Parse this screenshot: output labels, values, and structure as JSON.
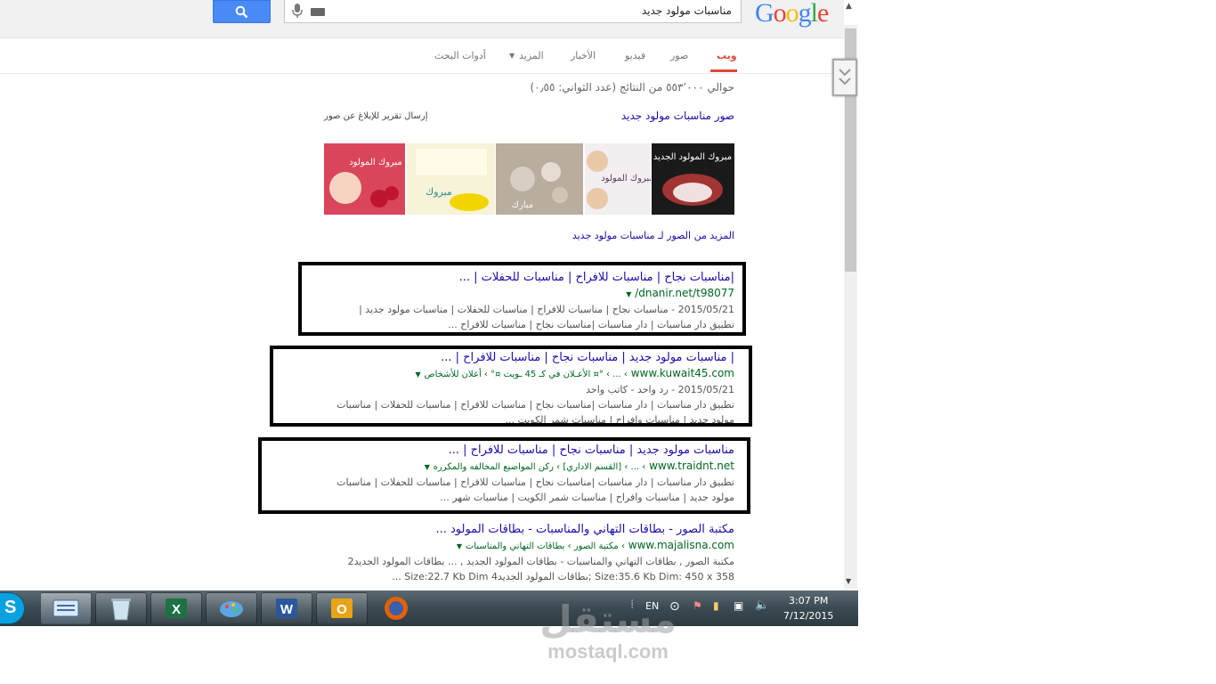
{
  "search": {
    "logo": "Google",
    "query": "مناسبات مولود جديد"
  },
  "tabs": [
    "ويب",
    "صور",
    "فيديو",
    "الأخبار",
    "المزيد",
    "أدوات البحث"
  ],
  "result_stats": "حوالي ٥٥٣٬٠٠٠ من النتائج (عدد الثواني: ٠٫٥٥)",
  "images": {
    "header": "صور مناسبات مولود جديد",
    "report": "إرسال تقرير للإبلاغ عن صور",
    "more": "المزيد من الصور لـ مناسبات مولود جديد",
    "thumbs": [
      {
        "text": "مبروك المولود الجديد",
        "bg": "#1a1a1a",
        "fg": "#ffffff"
      },
      {
        "text": "مبروك المولود",
        "bg": "#f3eef0",
        "fg": "#5a3a60"
      },
      {
        "text": "مبارك",
        "bg": "#b8ad9e",
        "fg": "#fdfaf5"
      },
      {
        "text": "مبروك",
        "bg": "#f6f3d8",
        "fg": "#2d8a8a"
      },
      {
        "text": "مبروك المولود",
        "bg": "#d9465c",
        "fg": "#ffffff"
      }
    ]
  },
  "results": [
    {
      "title": "|مناسبات نجاح | مناسبات للافراح | مناسبات للحفلات | ...",
      "url": "dnanir.net/t98077/",
      "snippet1": "2015/05/21 - مناسبات نجاح | مناسبات للافراح | مناسبات للحفلات | مناسبات مولود جديد |",
      "snippet2": "تطبيق دار مناسبات | دار مناسبات |مناسبات نجاح | مناسبات للافراح ..."
    },
    {
      "title": "| مناسبات مولود جديد | مناسبات نجاح | مناسبات للافراح | ...",
      "url": "www.kuwait45.com",
      "crumbs": "› ... › °¤ الأعـلان في كـ 45 ـويت ¤° › أعلان للأشخاص",
      "snippet1": "2015/05/21 - رد واحد - كاتب واحد",
      "snippet2": "تطبيق دار مناسبات | دار مناسبات |مناسبات نجاح | مناسبات للافراح | مناسبات للحفلات | مناسبات",
      "snippet3": "مولود جديد | مناسبات وافراح | مناسبات شمر الكويت ..."
    },
    {
      "title": "مناسبات مولود جديد | مناسبات نجاح | مناسبات للافراح | ...",
      "url": "www.traidnt.net",
      "crumbs": "› ... › [القسم الاداري] › ركن المواضيع المخالفه والمكرره",
      "snippet1": "تطبيق دار مناسبات | دار مناسبات |مناسبات نجاح | مناسبات للافراح | مناسبات للحفلات | مناسبات",
      "snippet2": "مولود جديد | مناسبات وافراح | مناسبات شمر الكويت | مناسبات شهر ..."
    },
    {
      "title": "مكتبة الصور - بطاقات التهاني والمناسبات - بطاقات المولود ...",
      "url": "www.majalisna.com",
      "crumbs": "› مكتبة الصور › بطاقات التهاني والمناسبات",
      "snippet1": "مكتبة الصور , بطاقات التهاني والمناسبات - بطاقات المولود الجديد , ... بطاقات المولود الجديد2",
      "snippet2": "Size:35.6 Kb Dim: 450 x 358 ;بطاقات المولود الجديد4 Size:22.7 Kb Dim ..."
    }
  ],
  "taskbar": {
    "lang": "EN",
    "time": "3:07 PM",
    "date": "7/12/2015"
  },
  "watermark": {
    "arabic": "مستقل",
    "latin": "mostaql.com"
  },
  "colors": {
    "google_blue": "#4285f4",
    "link": "#1a0dab",
    "url_green": "#006621",
    "active_tab": "#dd4b39",
    "search_button": "#4a8af4"
  }
}
